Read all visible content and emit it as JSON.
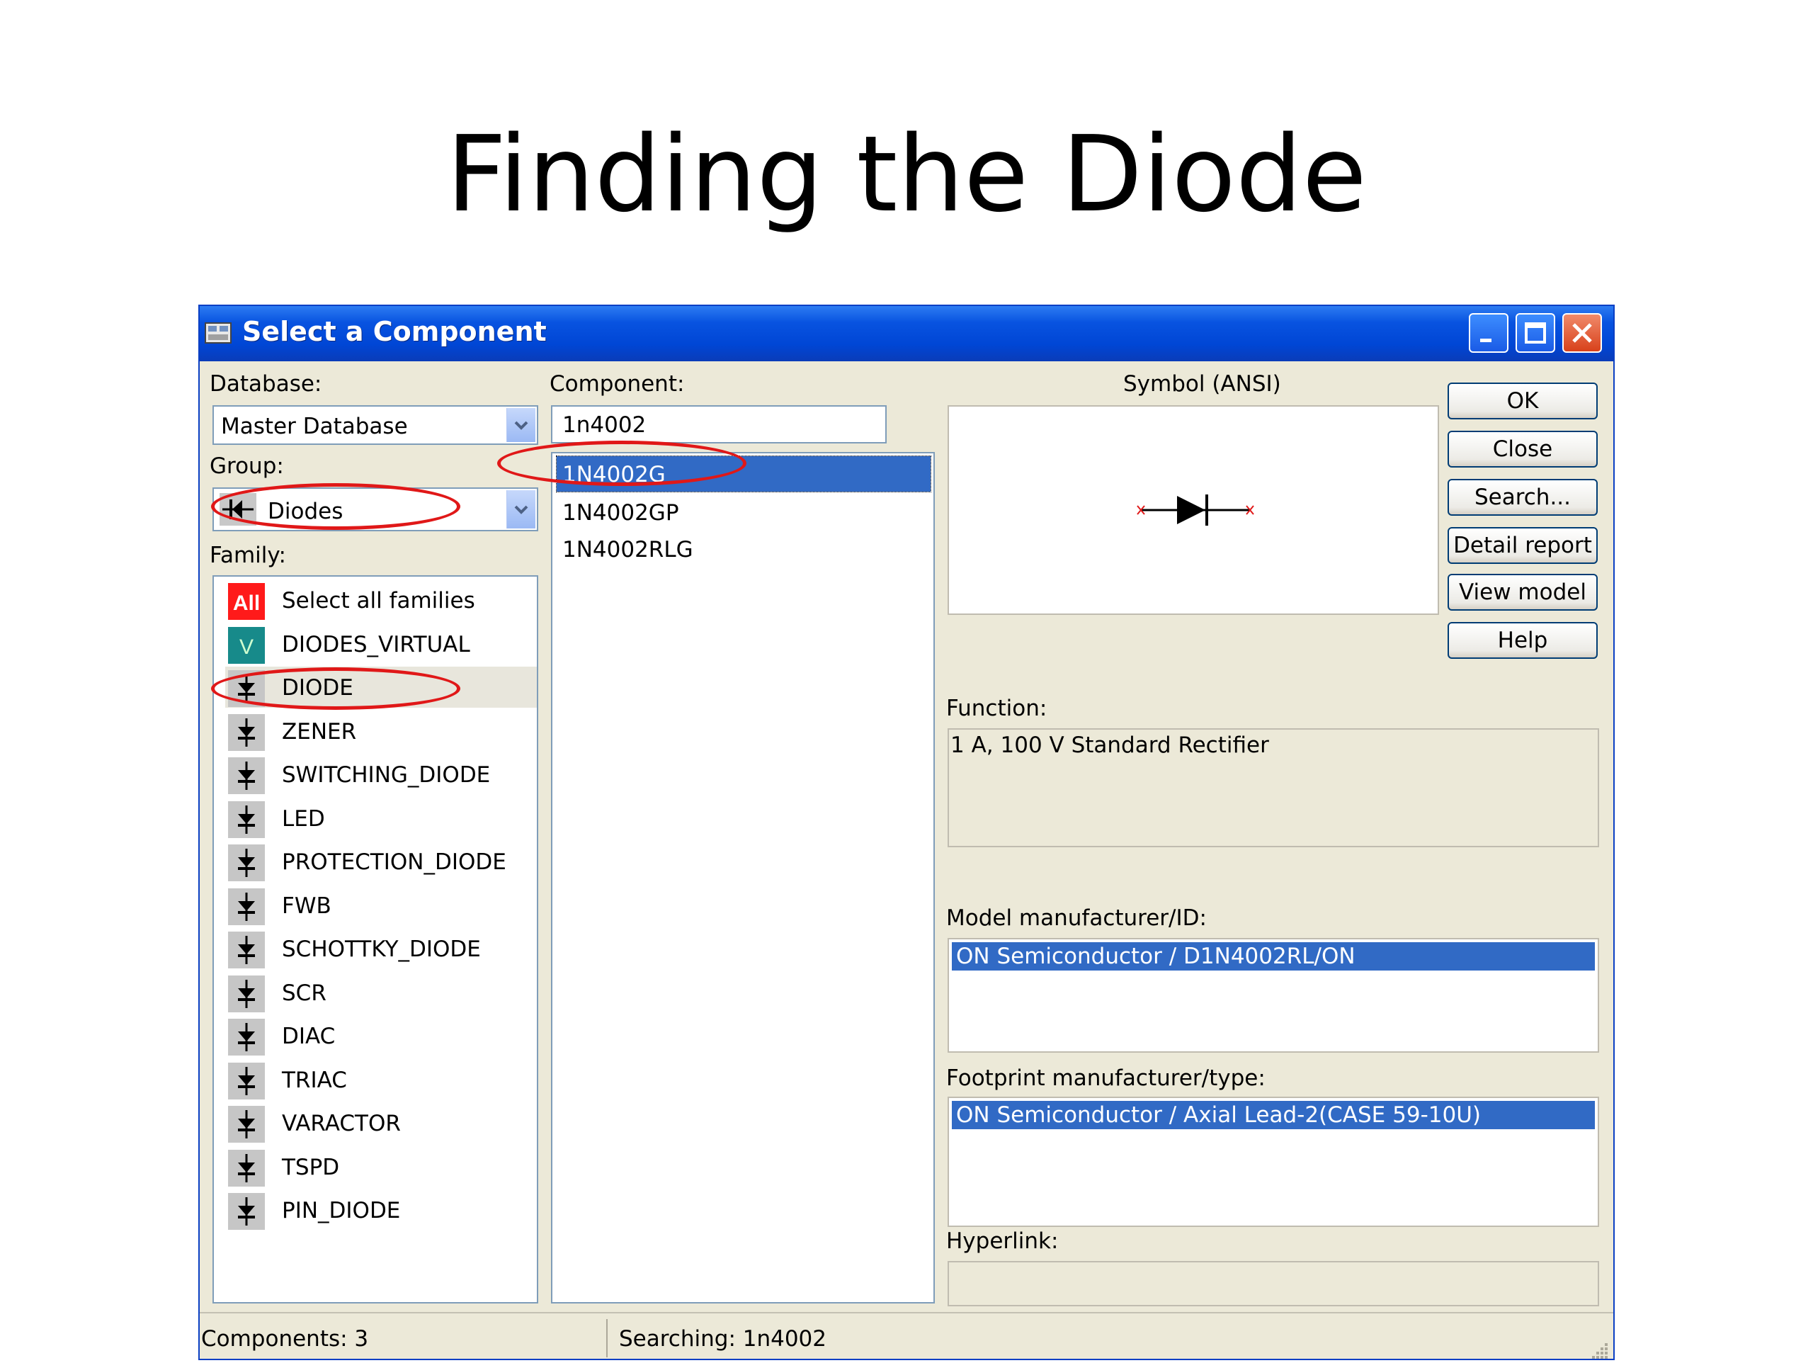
{
  "slide": {
    "title": "Finding the Diode"
  },
  "dialog": {
    "title": "Select a Component",
    "database": {
      "label": "Database:",
      "value": "Master Database"
    },
    "group": {
      "label": "Group:",
      "value": "Diodes"
    },
    "family": {
      "label": "Family:",
      "items": [
        {
          "label": "Select all families",
          "icon": "all-icon"
        },
        {
          "label": "DIODES_VIRTUAL",
          "icon": "virtual-icon"
        },
        {
          "label": "DIODE",
          "icon": "diode-icon"
        },
        {
          "label": "ZENER",
          "icon": "zener-icon"
        },
        {
          "label": "SWITCHING_DIODE",
          "icon": "switching-diode-icon"
        },
        {
          "label": "LED",
          "icon": "led-icon"
        },
        {
          "label": "PROTECTION_DIODE",
          "icon": "protection-diode-icon"
        },
        {
          "label": "FWB",
          "icon": "fwb-icon"
        },
        {
          "label": "SCHOTTKY_DIODE",
          "icon": "schottky-diode-icon"
        },
        {
          "label": "SCR",
          "icon": "scr-icon"
        },
        {
          "label": "DIAC",
          "icon": "diac-icon"
        },
        {
          "label": "TRIAC",
          "icon": "triac-icon"
        },
        {
          "label": "VARACTOR",
          "icon": "varactor-icon"
        },
        {
          "label": "TSPD",
          "icon": "tspd-icon"
        },
        {
          "label": "PIN_DIODE",
          "icon": "pin-diode-icon"
        }
      ],
      "all_badge": "All",
      "virtual_badge": "V"
    },
    "component": {
      "label": "Component:",
      "search_value": "1n4002",
      "items": [
        "1N4002G",
        "1N4002GP",
        "1N4002RLG"
      ]
    },
    "symbol": {
      "label": "Symbol (ANSI)"
    },
    "buttons": {
      "ok": "OK",
      "close": "Close",
      "search": "Search...",
      "detail_report": "Detail report",
      "view_model": "View model",
      "help": "Help"
    },
    "function": {
      "label": "Function:",
      "value": "1 A, 100 V Standard Rectifier"
    },
    "model": {
      "label": "Model manufacturer/ID:",
      "value": "ON Semiconductor / D1N4002RL/ON"
    },
    "footprint": {
      "label": "Footprint manufacturer/type:",
      "value": "ON Semiconductor / Axial Lead-2(CASE 59-10U)"
    },
    "hyperlink": {
      "label": "Hyperlink:",
      "value": ""
    },
    "status": {
      "components": "Components: 3",
      "searching": "Searching: 1n4002"
    },
    "colors": {
      "selection": "#316ac5",
      "titlebar": "#0046d5",
      "annotation": "#e01818"
    }
  }
}
